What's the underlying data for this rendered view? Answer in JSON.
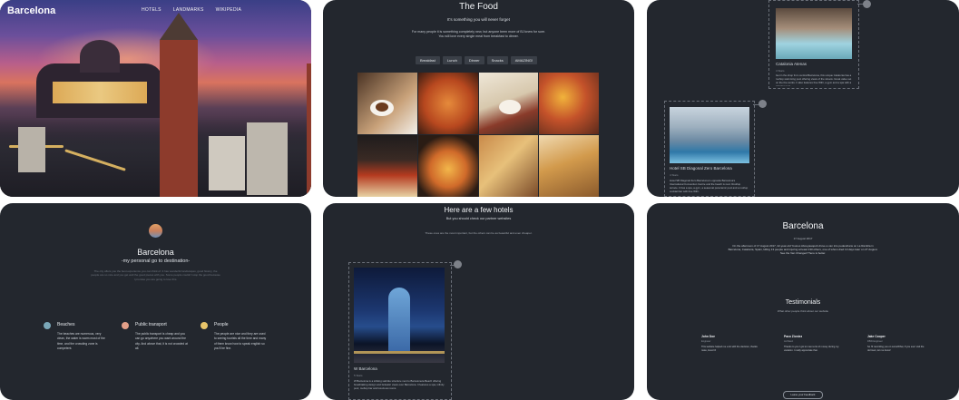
{
  "hero": {
    "brand": "Barcelona",
    "nav": [
      "HOTELS",
      "LANDMARKS",
      "WIKIPEDIA"
    ]
  },
  "food": {
    "title": "The Food",
    "subtitle": "It's something you will never forget",
    "description_line1": "For many people it is something completely new, but anyone been more of BJ knew for sure.",
    "description_line2": "You will love every single meal from breakfast to dinner.",
    "tabs": [
      "Breakfast",
      "Lunch",
      "Dinner",
      "Snacks",
      "AMAZING!"
    ]
  },
  "hotels_upper": {
    "hotel1": {
      "name": "Catalonia Atenas",
      "meta": "4 Stars",
      "text": "Get in the shop from central Barcelona, this unique Catalonia has a rooftop swimming pool offering views of the streets. Great value set on the the centre. It also features free WiFi, a gym and a spa with a relaxing pool."
    },
    "hotel2": {
      "name": "Hotel SB Diagonal Zero Barcelona",
      "meta": "4 Stars",
      "text": "Hotel SB Diagonal Zero Barcelona is opposite Barcelona's International Convention Centre and the beach is next. Rooftop terrace. It has a spa, a gym, a seasonal panoramic pool and a rooftop cocktail bar with free WiFi."
    }
  },
  "about": {
    "title": "Barcelona",
    "subtitle": "-my personal go to destination-",
    "text": "The city offers you the best experience you can think of. It has wonderful landscapes, good history, the people are so nice and you get well the good pieces with you. Some people couldn't stop the good because I promise you are going to love this.",
    "features": [
      {
        "title": "Beaches",
        "text": "The beaches are numerous, very clean, the water is warm most of the time, and the crowding zone is competent."
      },
      {
        "title": "Public transport",
        "text": "The public transport is cheap and you can go anywhere you want around the city. And above that, it is not crowded at all."
      },
      {
        "title": "People",
        "text": "The people are nice and they are used to seeing tourists all the time and many of them know how to speak english so you'll be fine."
      }
    ]
  },
  "hotels_lower": {
    "title": "Here are a few hotels",
    "subtitle": "But you should check our partner websites",
    "description": "These ones are the most important, but the others can be as beautiful and even cheaper.",
    "hotel": {
      "name": "W Barcelona",
      "meta": "5 Stars",
      "text": "W Barcelona is a striking sail-like structure next to Barceloneta Beach offering breathtaking design and fantastic views over Barcelona. It features a spa, infinity pool, rooftop bar and luxurious rooms."
    }
  },
  "story": {
    "title": "Barcelona",
    "date": "17 August 2017",
    "text": "On the afternoon of 17 August 2017, 22-year-old Younes Abouyaaqoub drove a van into pedestrians on La Rambla in Barcelona, Catalonia, Spain, killing 13 people and injuring at least 130 others, one of whom died 10 days later on 27 August. See the Van Changed There is better.",
    "testimonials_title": "Testimonials",
    "testimonials_subtitle": "What other people think about our website",
    "testimonials": [
      {
        "name": "John Doe",
        "role": "Engineer",
        "text": "This website helped me a lot with the decision, thanks mate, loved it!"
      },
      {
        "name": "Paco Zioniez",
        "role": "Architect",
        "text": "Thanks to you I got to meet a lot of money during my vacation. I really appreciate that."
      },
      {
        "name": "Jake Cooper",
        "role": "FBW Engineer",
        "text": "So I'll recording you on someWhat, If you ever visit the old town, let me know!"
      }
    ],
    "button": "Leave your Feedback"
  },
  "colors": {
    "card_bg": "#23272e",
    "page_bg": "#ffffff",
    "accent_tower": "#8d3b2c"
  }
}
